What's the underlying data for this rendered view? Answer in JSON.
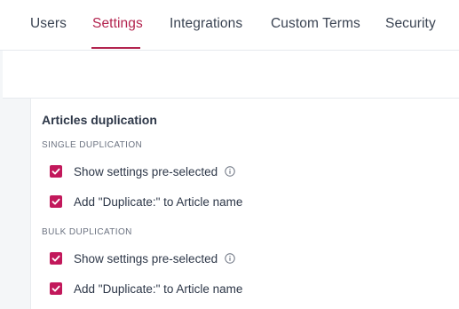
{
  "tabs": [
    {
      "label": "Users",
      "active": false
    },
    {
      "label": "Settings",
      "active": true
    },
    {
      "label": "Integrations",
      "active": false
    },
    {
      "label": "Custom Terms",
      "active": false
    },
    {
      "label": "Security",
      "active": false
    }
  ],
  "accent_color": "#b3244f",
  "checkbox_color": "#c2185b",
  "section": {
    "title": "Articles duplication",
    "groups": [
      {
        "label": "SINGLE DUPLICATION",
        "options": [
          {
            "label": "Show settings pre-selected",
            "checked": true,
            "info_icon": "info-icon"
          },
          {
            "label": "Add \"Duplicate:\" to Article name",
            "checked": true
          }
        ]
      },
      {
        "label": "BULK DUPLICATION",
        "options": [
          {
            "label": "Show settings pre-selected",
            "checked": true,
            "info_icon": "info-icon"
          },
          {
            "label": "Add \"Duplicate:\" to Article name",
            "checked": true
          }
        ]
      }
    ]
  }
}
